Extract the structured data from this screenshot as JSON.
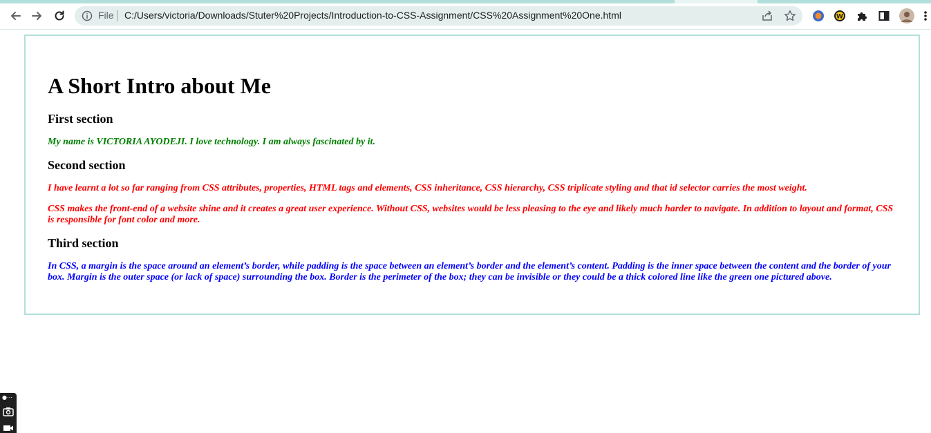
{
  "browser": {
    "omnibox": {
      "scheme_label": "File",
      "url": "C:/Users/victoria/Downloads/Stuter%20Projects/Introduction-to-CSS-Assignment/CSS%20Assignment%20One.html"
    },
    "icons": {
      "back": "back-arrow-icon",
      "forward": "forward-arrow-icon",
      "reload": "reload-icon",
      "info": "info-icon",
      "share": "share-icon",
      "bookmark": "star-icon",
      "extensions": "puzzle-icon",
      "sidepanel": "side-panel-icon",
      "menu": "kebab-menu-icon"
    }
  },
  "page": {
    "title": "A Short Intro about Me",
    "sections": [
      {
        "heading": "First section",
        "color": "#008000",
        "paragraphs": [
          "My name is VICTORIA AYODEJI. I love technology. I am always fascinated by it."
        ]
      },
      {
        "heading": "Second section",
        "color": "#ff0000",
        "paragraphs": [
          "I have learnt a lot so far ranging from CSS attributes, properties, HTML tags and elements, CSS inheritance, CSS hierarchy, CSS triplicate styling and that id selector carries the most weight.",
          "CSS makes the front-end of a website shine and it creates a great user experience. Without CSS, websites would be less pleasing to the eye and likely much harder to navigate. In addition to layout and format, CSS is responsible for font color and more."
        ]
      },
      {
        "heading": "Third section",
        "color": "#0000ff",
        "paragraphs": [
          "In CSS, a margin is the space around an element’s border, while padding is the space between an element’s border and the element’s content. Padding is the inner space between the content and the border of your box. Margin is the outer space (or lack of space) surrounding the box. Border is the perimeter of the box; they can be invisible or they could be a thick colored line like the green one pictured above."
        ]
      }
    ],
    "border_color": "#b2dfdb"
  }
}
